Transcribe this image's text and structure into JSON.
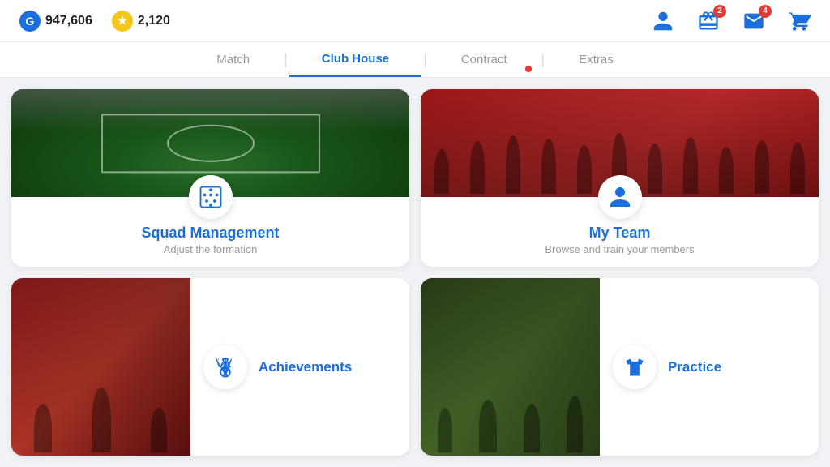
{
  "topbar": {
    "currency_g_label": "G",
    "currency_g_value": "947,606",
    "currency_star_label": "★",
    "currency_star_value": "2,120",
    "gift_badge": "2",
    "mail_badge": "4"
  },
  "nav": {
    "items": [
      {
        "id": "match",
        "label": "Match",
        "active": false
      },
      {
        "id": "clubhouse",
        "label": "Club House",
        "active": true
      },
      {
        "id": "contract",
        "label": "Contract",
        "active": false
      },
      {
        "id": "extras",
        "label": "Extras",
        "active": false
      }
    ]
  },
  "cards": {
    "squad_management": {
      "title": "Squad Management",
      "subtitle": "Adjust the formation"
    },
    "my_team": {
      "title": "My Team",
      "subtitle": "Browse and train your members"
    },
    "achievements": {
      "title": "Achievements"
    },
    "practice": {
      "title": "Practice"
    }
  }
}
